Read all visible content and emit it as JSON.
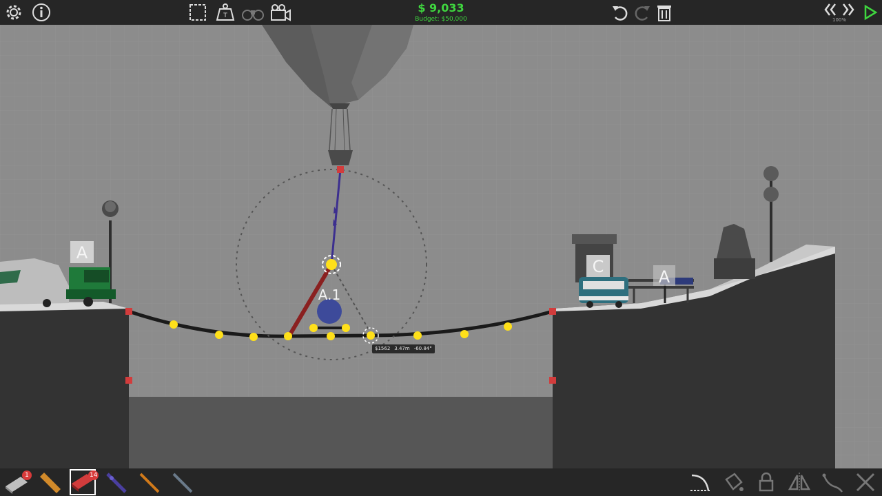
{
  "hud": {
    "money": "$ 9,033",
    "budget": "Budget: $50,000",
    "sim_speed": "100%"
  },
  "colors": {
    "money_green": "#3fd63f",
    "joint_yellow": "#ffe01a",
    "anchor_red": "#d23c3c",
    "rope_blue": "#3c2f8f",
    "hydraulic_red": "#8a2020",
    "road_black": "#1a1a1a",
    "ground_dark": "#333333",
    "toolbar_bg": "#262626"
  },
  "top_left_icons": [
    {
      "name": "settings-gear-icon",
      "interactable": true
    },
    {
      "name": "info-icon",
      "interactable": true
    }
  ],
  "top_center_icons": [
    {
      "name": "select-box-icon",
      "interactable": true
    },
    {
      "name": "weight-icon",
      "interactable": true
    },
    {
      "name": "binoculars-icon",
      "interactable": true
    },
    {
      "name": "camera-icon",
      "interactable": true
    }
  ],
  "top_right_icons": [
    {
      "name": "undo-icon",
      "interactable": true
    },
    {
      "name": "redo-icon",
      "interactable": true
    },
    {
      "name": "trash-icon",
      "interactable": true
    }
  ],
  "sim_controls": [
    {
      "name": "rewind-icon",
      "interactable": true
    },
    {
      "name": "fast-forward-icon",
      "interactable": true
    },
    {
      "name": "play-icon",
      "interactable": true
    }
  ],
  "materials": [
    {
      "name": "road-material",
      "badge": "1"
    },
    {
      "name": "wood-material",
      "badge": ""
    },
    {
      "name": "reinforced-road-material",
      "badge": "14"
    },
    {
      "name": "steel-material",
      "badge": ""
    },
    {
      "name": "rope-material",
      "badge": ""
    },
    {
      "name": "cable-material",
      "badge": ""
    }
  ],
  "bottom_tools": [
    {
      "name": "arc-tool-icon"
    },
    {
      "name": "paint-bucket-icon"
    },
    {
      "name": "lock-icon"
    },
    {
      "name": "mirror-icon"
    },
    {
      "name": "spring-icon"
    },
    {
      "name": "split-joint-icon"
    }
  ],
  "scene": {
    "vehicle_labels": {
      "truck": "A",
      "bus": "C",
      "bike": "A"
    },
    "hydraulic_label": "A.1",
    "tooltip": {
      "cost": "$1562",
      "length": "3.47m",
      "angle": "-60.84°"
    }
  }
}
